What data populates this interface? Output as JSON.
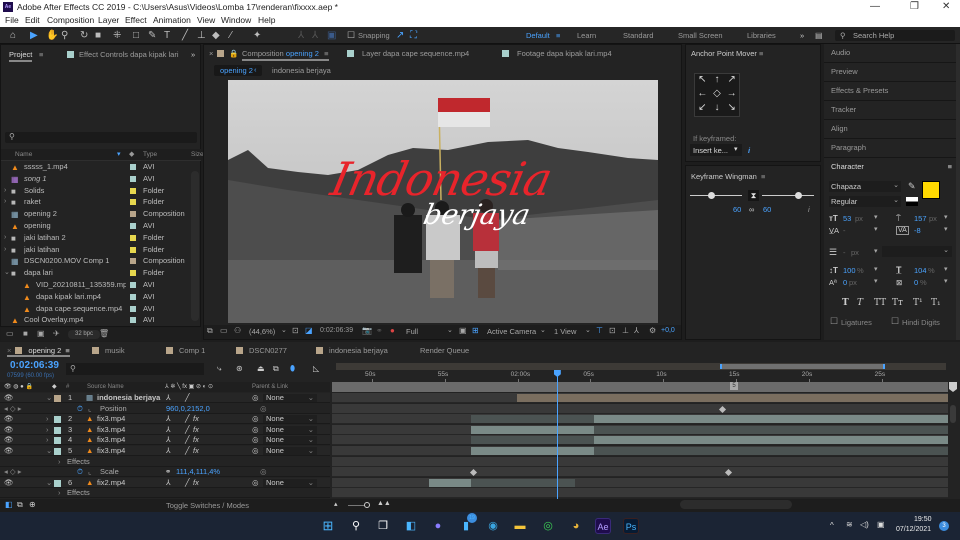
{
  "window": {
    "title": "Adobe After Effects CC 2019 - C:\\Users\\Asus\\Videos\\Lomba 17\\renderan\\fixxxx.aep *",
    "minimize": "—",
    "restore": "❐",
    "close": "✕"
  },
  "menu": [
    "File",
    "Edit",
    "Composition",
    "Layer",
    "Effect",
    "Animation",
    "View",
    "Window",
    "Help"
  ],
  "toolbar": {
    "snapping_label": "Snapping",
    "workspaces": [
      {
        "label": "Default",
        "active": true
      },
      {
        "label": "Learn",
        "active": false
      },
      {
        "label": "Standard",
        "active": false
      },
      {
        "label": "Small Screen",
        "active": false
      },
      {
        "label": "Libraries",
        "active": false
      }
    ],
    "more": "»",
    "search_placeholder": "Search Help"
  },
  "project_panel": {
    "tab_project": "Project",
    "tab_effect_controls": "Effect Controls dapa kipak lari.r",
    "more": "»",
    "search_placeholder": "",
    "col_name": "Name",
    "col_type": "Type",
    "col_size": "Size",
    "bpc": "32 bpc",
    "items": [
      {
        "name": "sssss_1.mp4",
        "type": "AVI",
        "icon": "vlc-icon",
        "label_color": "#a9d0cc",
        "twirl": ""
      },
      {
        "name": "song 1",
        "type": "AVI",
        "icon": "footage-icon",
        "label_color": "#a9d0cc",
        "twirl": ""
      },
      {
        "name": "Solids",
        "type": "Folder",
        "icon": "folder-icon",
        "label_color": "#e6d74e",
        "twirl": "›"
      },
      {
        "name": "raket",
        "type": "Folder",
        "icon": "folder-icon",
        "label_color": "#e6d74e",
        "twirl": "›"
      },
      {
        "name": "opening 2",
        "type": "Composition",
        "icon": "composition-icon",
        "label_color": "#b8a58a",
        "twirl": ""
      },
      {
        "name": "opening",
        "type": "AVI",
        "icon": "vlc-icon",
        "label_color": "#a9d0cc",
        "twirl": ""
      },
      {
        "name": "jaki latihan 2",
        "type": "Folder",
        "icon": "folder-icon",
        "label_color": "#e6d74e",
        "twirl": "›"
      },
      {
        "name": "jaki latihan",
        "type": "Folder",
        "icon": "folder-icon",
        "label_color": "#e6d74e",
        "twirl": "›"
      },
      {
        "name": "DSCN0200.MOV Comp 1",
        "type": "Composition",
        "icon": "composition-icon",
        "label_color": "#b8a58a",
        "twirl": ""
      },
      {
        "name": "dapa lari",
        "type": "Folder",
        "icon": "folder-icon",
        "label_color": "#e6d74e",
        "twirl": "⌄"
      },
      {
        "name": "VID_20210811_135359.mp4",
        "type": "AVI",
        "icon": "vlc-icon",
        "label_color": "#a9d0cc",
        "twirl": "",
        "indent": true
      },
      {
        "name": "dapa kipak lari.mp4",
        "type": "AVI",
        "icon": "vlc-icon",
        "label_color": "#a9d0cc",
        "twirl": "",
        "indent": true
      },
      {
        "name": "dapa cape sequence.mp4",
        "type": "AVI",
        "icon": "vlc-icon",
        "label_color": "#a9d0cc",
        "twirl": "",
        "indent": true
      },
      {
        "name": "Cool Overlay.mp4",
        "type": "AVI",
        "icon": "vlc-icon",
        "label_color": "#a9d0cc",
        "twirl": ""
      }
    ]
  },
  "comp_panel": {
    "tab_composition_prefix": "Composition",
    "tab_composition_name": "opening 2",
    "tab_layer": "Layer  dapa cape sequence.mp4",
    "tab_footage": "Footage  dapa kipak lari.mp4",
    "breadcrumb": [
      "opening 2",
      "indonesia berjaya"
    ],
    "title_line1": "Indonesia",
    "title_line2": "berjaya",
    "zoom": "(44,6%)",
    "timecode": "0:02:06:39",
    "resolution": "Full",
    "camera": "Active Camera",
    "views": "1 View",
    "exposure": "+0,0"
  },
  "anchor_point_mover": {
    "title": "Anchor Point Mover",
    "arrows": [
      "↖",
      "↑",
      "↗",
      "←",
      "◇",
      "→",
      "↙",
      "↓",
      "↘"
    ],
    "if_keyframed": "If keyframed:",
    "mode": "Insert ke...",
    "info": "i"
  },
  "keyframe_wingman": {
    "title": "Keyframe Wingman",
    "left_value": "60",
    "right_value": "60",
    "left_influence": 0.4,
    "right_influence": 0.7,
    "info": "i"
  },
  "right_panels": [
    "Audio",
    "Preview",
    "Effects & Presets",
    "Tracker",
    "Align",
    "Paragraph"
  ],
  "character": {
    "title": "Character",
    "font": "Chapaza",
    "style": "Regular",
    "fill_color": "#ffd800",
    "font_size": "53",
    "leading": "157",
    "kerning": "-",
    "tracking": "-8",
    "stroke_width": "-",
    "vert_scale": "100",
    "horiz_scale": "104",
    "baseline_shift": "0",
    "tsume": "0",
    "unit_px": "px",
    "unit_pct": "%",
    "style_buttons": [
      "T",
      "T",
      "TT",
      "Tт",
      "T¹",
      "T₁"
    ],
    "ligatures": "Ligatures",
    "hindi_digits": "Hindi Digits"
  },
  "timeline": {
    "tabs": [
      {
        "label": "opening 2",
        "color": "#b8a58a",
        "active": true
      },
      {
        "label": "musik",
        "color": "#b8a58a"
      },
      {
        "label": "Comp 1",
        "color": "#b8a58a"
      },
      {
        "label": "DSCN0277",
        "color": "#b8a58a"
      },
      {
        "label": "indonesia berjaya",
        "color": "#b8a58a"
      },
      {
        "label": "Render Queue",
        "color": ""
      }
    ],
    "timecode": "0:02:06:39",
    "frame_info": "07599 (60.00 fps)",
    "col_source_name": "Source Name",
    "col_parent": "Parent & Link",
    "ruler": [
      "50s",
      "55s",
      "02:00s",
      "05s",
      "10s",
      "15s",
      "20s",
      "25s"
    ],
    "playhead_position": 0.365,
    "work_area": [
      0.63,
      0.9
    ],
    "toggle_label": "Toggle Switches / Modes",
    "layers": [
      {
        "num": "1",
        "name": "indonesia berjaya",
        "label_color": "#b8a58a",
        "icon": "composition-icon",
        "parent": "None",
        "expanded": true,
        "fx": false
      },
      {
        "prop": "Position",
        "value": "960,0,2152,0"
      },
      {
        "num": "2",
        "name": "fix3.mp4",
        "label_color": "#a9d0cc",
        "icon": "vlc-icon",
        "parent": "None",
        "expanded": false,
        "fx": true
      },
      {
        "num": "3",
        "name": "fix3.mp4",
        "label_color": "#a9d0cc",
        "icon": "vlc-icon",
        "parent": "None",
        "expanded": false,
        "fx": true
      },
      {
        "num": "4",
        "name": "fix3.mp4",
        "label_color": "#a9d0cc",
        "icon": "vlc-icon",
        "parent": "None",
        "expanded": false,
        "fx": true
      },
      {
        "num": "5",
        "name": "fix3.mp4",
        "label_color": "#a9d0cc",
        "icon": "vlc-icon",
        "parent": "None",
        "expanded": true,
        "fx": true
      },
      {
        "group": "Effects"
      },
      {
        "prop": "Scale",
        "value": "111,4,111,4%"
      },
      {
        "num": "6",
        "name": "fix2.mp4",
        "label_color": "#a9d0cc",
        "icon": "vlc-icon",
        "parent": "None",
        "expanded": true,
        "fx": true
      },
      {
        "group": "Effects"
      }
    ]
  },
  "taskbar": {
    "time": "19:50",
    "date": "07/12/2021",
    "notifications": "3",
    "badge_app": "19"
  }
}
